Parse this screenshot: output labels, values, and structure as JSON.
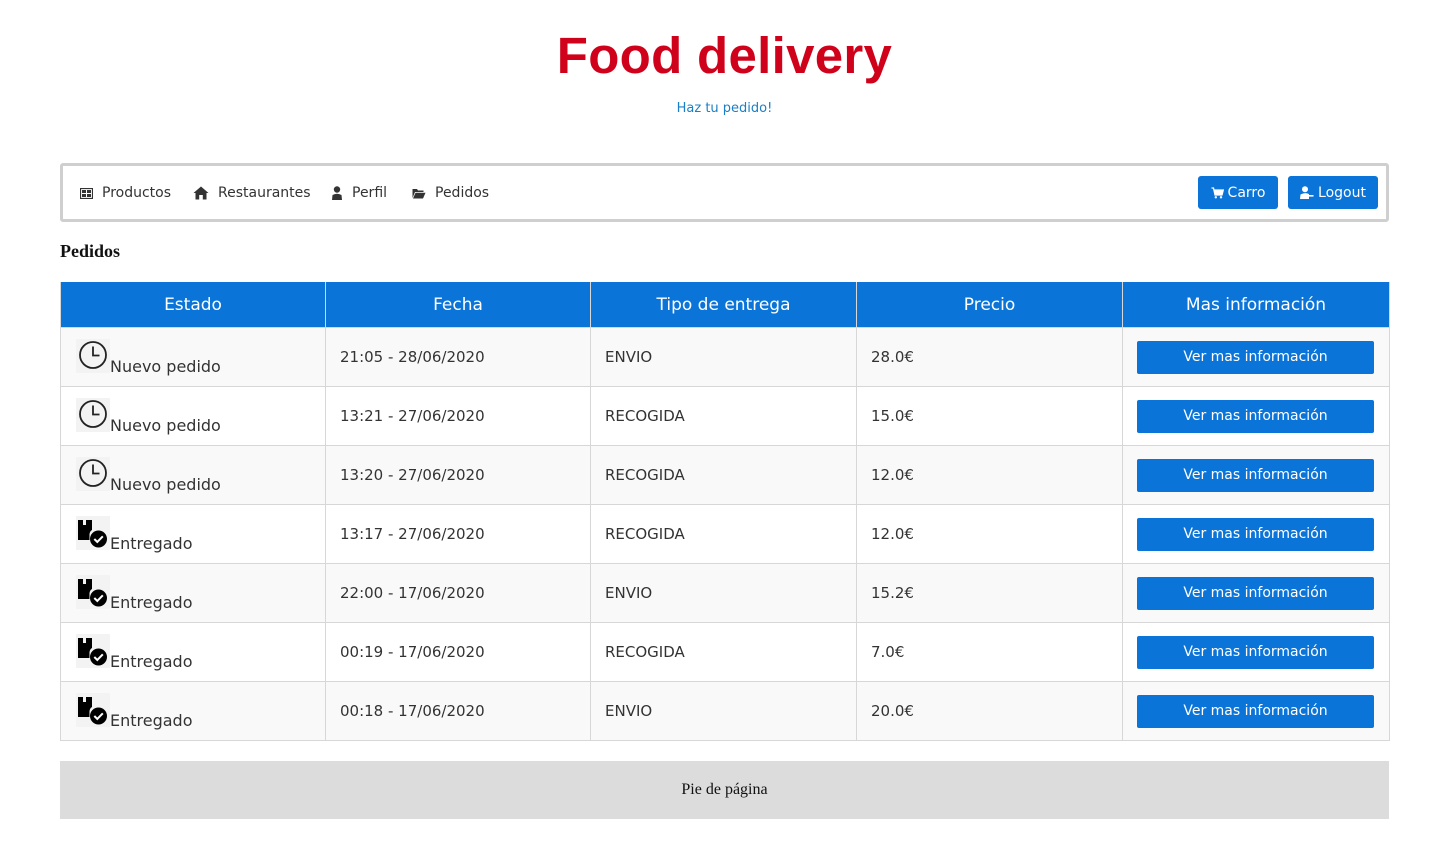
{
  "header": {
    "title": "Food delivery",
    "subtitle": "Haz tu pedido!"
  },
  "nav": {
    "items": [
      {
        "label": "Productos",
        "icon": "grid-icon"
      },
      {
        "label": "Restaurantes",
        "icon": "home-icon"
      },
      {
        "label": "Perfil",
        "icon": "user-icon"
      },
      {
        "label": "Pedidos",
        "icon": "folder-open-icon"
      }
    ],
    "cart_label": "Carro",
    "logout_label": "Logout"
  },
  "section_title": "Pedidos",
  "table": {
    "columns": [
      "Estado",
      "Fecha",
      "Tipo de entrega",
      "Precio",
      "Mas información"
    ],
    "rows": [
      {
        "estado": "Nuevo pedido",
        "icon": "clock-icon",
        "fecha": "21:05 - 28/06/2020",
        "tipo": "ENVIO",
        "precio": "28.0€",
        "accion": "Ver mas información"
      },
      {
        "estado": "Nuevo pedido",
        "icon": "clock-icon",
        "fecha": "13:21 - 27/06/2020",
        "tipo": "RECOGIDA",
        "precio": "15.0€",
        "accion": "Ver mas información"
      },
      {
        "estado": "Nuevo pedido",
        "icon": "clock-icon",
        "fecha": "13:20 - 27/06/2020",
        "tipo": "RECOGIDA",
        "precio": "12.0€",
        "accion": "Ver mas información"
      },
      {
        "estado": "Entregado",
        "icon": "delivered-package-icon",
        "fecha": "13:17 - 27/06/2020",
        "tipo": "RECOGIDA",
        "precio": "12.0€",
        "accion": "Ver mas información"
      },
      {
        "estado": "Entregado",
        "icon": "delivered-package-icon",
        "fecha": "22:00 - 17/06/2020",
        "tipo": "ENVIO",
        "precio": "15.2€",
        "accion": "Ver mas información"
      },
      {
        "estado": "Entregado",
        "icon": "delivered-package-icon",
        "fecha": "00:19 - 17/06/2020",
        "tipo": "RECOGIDA",
        "precio": "7.0€",
        "accion": "Ver mas información"
      },
      {
        "estado": "Entregado",
        "icon": "delivered-package-icon",
        "fecha": "00:18 - 17/06/2020",
        "tipo": "ENVIO",
        "precio": "20.0€",
        "accion": "Ver mas información"
      }
    ]
  },
  "footer": {
    "text": "Pie de página"
  },
  "colors": {
    "brand_red": "#d0021b",
    "primary_blue": "#0a74d8",
    "link_blue": "#1a7fc4"
  }
}
